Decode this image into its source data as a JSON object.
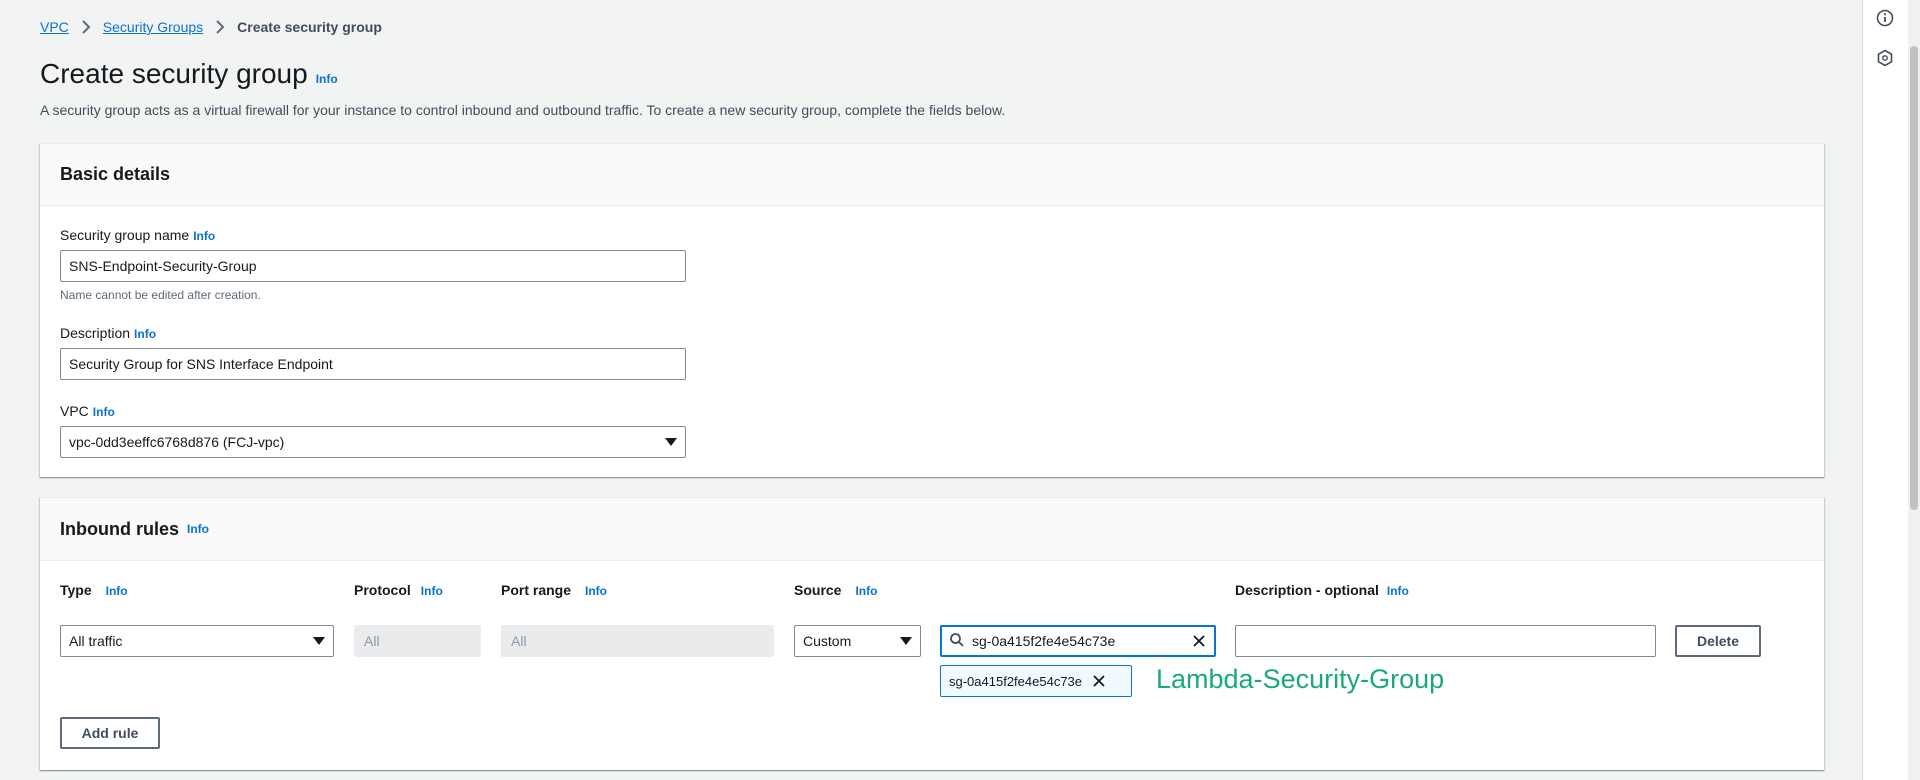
{
  "breadcrumb": {
    "vpc": "VPC",
    "security_groups": "Security Groups",
    "current": "Create security group"
  },
  "page": {
    "title": "Create security group",
    "title_info": "Info",
    "description": "A security group acts as a virtual firewall for your instance to control inbound and outbound traffic. To create a new security group, complete the fields below."
  },
  "basic_details": {
    "heading": "Basic details",
    "name_label": "Security group name",
    "name_info": "Info",
    "name_value": "SNS-Endpoint-Security-Group",
    "name_constraint": "Name cannot be edited after creation.",
    "description_label": "Description",
    "description_info": "Info",
    "description_value": "Security Group for SNS Interface Endpoint",
    "vpc_label": "VPC",
    "vpc_info": "Info",
    "vpc_value": "vpc-0dd3eeffc6768d876 (FCJ-vpc)"
  },
  "inbound_rules": {
    "heading": "Inbound rules",
    "heading_info": "Info",
    "columns": {
      "type": "Type",
      "protocol": "Protocol",
      "port_range": "Port range",
      "source": "Source",
      "description": "Description - optional",
      "info": "Info"
    },
    "rule": {
      "type": "All traffic",
      "protocol": "All",
      "port_range": "All",
      "source_type": "Custom",
      "source_search": "sg-0a415f2fe4e54c73e",
      "source_token": "sg-0a415f2fe4e54c73e",
      "description": ""
    },
    "delete_label": "Delete",
    "add_rule_label": "Add rule"
  },
  "annotation": {
    "text": "Lambda-Security-Group",
    "color": "#1aaa7a"
  },
  "icons": {
    "rail_top": "info-circle-icon",
    "rail_second": "hexagon-icon",
    "search": "search-icon",
    "clear": "close-icon",
    "token_remove": "close-icon",
    "caret": "caret-down-icon",
    "separator": "chevron-right-icon"
  },
  "colors": {
    "link": "#0972d3",
    "background": "#f2f3f3",
    "annotation": "#1aaa7a"
  }
}
